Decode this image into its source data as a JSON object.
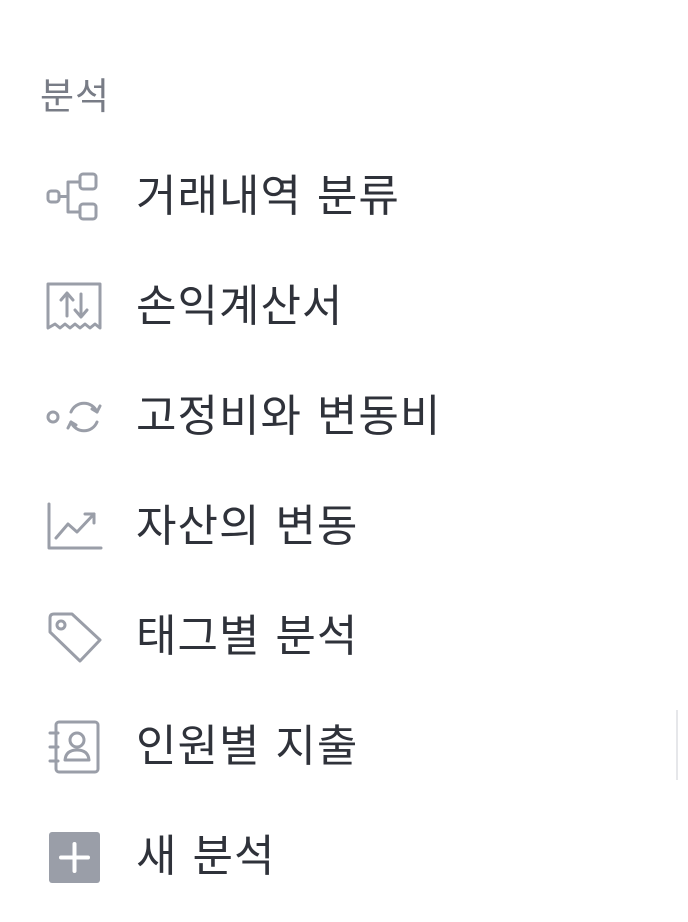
{
  "section": {
    "title": "분석"
  },
  "menu": {
    "items": [
      {
        "label": "거래내역 분류",
        "icon": "flow-branch-icon"
      },
      {
        "label": "손익계산서",
        "icon": "receipt-updown-icon"
      },
      {
        "label": "고정비와 변동비",
        "icon": "cycle-icon"
      },
      {
        "label": "자산의 변동",
        "icon": "trend-chart-icon"
      },
      {
        "label": "태그별 분석",
        "icon": "tag-icon"
      },
      {
        "label": "인원별 지출",
        "icon": "contact-book-icon"
      },
      {
        "label": "새 분석",
        "icon": "plus-square-icon"
      }
    ]
  },
  "colors": {
    "icon": "#9a9ea8",
    "text": "#2f323a",
    "section_title": "#787c86",
    "background": "#ffffff"
  }
}
